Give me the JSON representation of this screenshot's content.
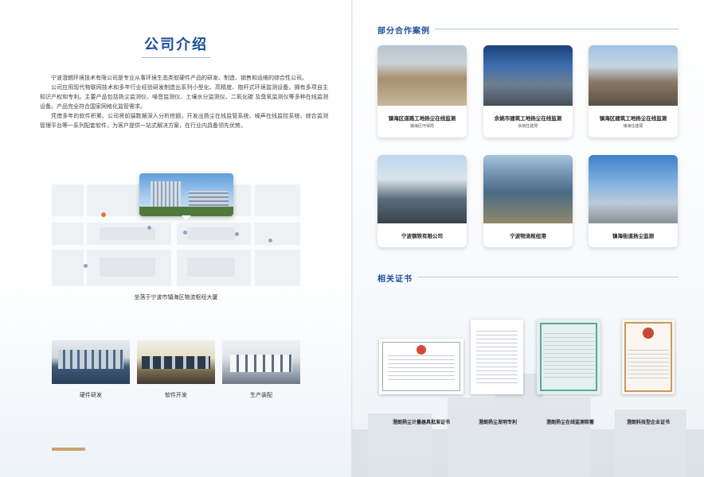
{
  "left_page": {
    "title": "公司介绍",
    "paragraphs": [
      "宁波澄朗环境技术有限公司是专业从事环境生态类软硬件产品的研发、制造、销售和运维的综合性公司。",
      "公司应用现代物联网技术和多年行业经验研发制造出系列小型化、高精度、抱杆式环境监测设备。拥有多项自主知识产权和专利。主要产品包括扬尘监测仪、噪音监测仪、土壤水分监测仪、二氧化碳 及臭氧监测仪等多种在线监测设备。产品完全符合国家网格化监管需求。",
      "凭借多年的软件积累、公司将前端数据深入分析挖掘，开发出扬尘在线监管系统、噪声在线监控系统、综合监测管理平台等一系列配套软件，为客户提供一站式解决方案，在行业内具备领先优势。"
    ],
    "map_caption": "坐落于宁波市镇海区物流枢纽大厦",
    "facilities": [
      {
        "label": "硬件研发"
      },
      {
        "label": "软件开发"
      },
      {
        "label": "生产装配"
      }
    ]
  },
  "right_page": {
    "cases_title": "部分合作案例",
    "cases": [
      {
        "title": "镇海区道路工地扬尘在线监测",
        "subtitle": "镇海区环保局"
      },
      {
        "title": "余姚市建筑工地扬尘在线监测",
        "subtitle": "余姚住建局"
      },
      {
        "title": "镇海区建筑工地扬尘在线监测",
        "subtitle": "镇海住建局"
      },
      {
        "title": "宁波钢铁有限公司",
        "subtitle": ""
      },
      {
        "title": "宁波物流枢纽港",
        "subtitle": ""
      },
      {
        "title": "镇海街道扬尘监测",
        "subtitle": ""
      }
    ],
    "certs_title": "相关证书",
    "certs": [
      {
        "label": "澄朗扬尘计量器具批准证书"
      },
      {
        "label": "澄朗扬尘发明专利"
      },
      {
        "label": "澄朗扬尘在线监测软著"
      },
      {
        "label": "澄朗科技型企业证书"
      }
    ]
  },
  "colors": {
    "accent_blue": "#1a4f9c",
    "gold": "#c9a66b"
  }
}
